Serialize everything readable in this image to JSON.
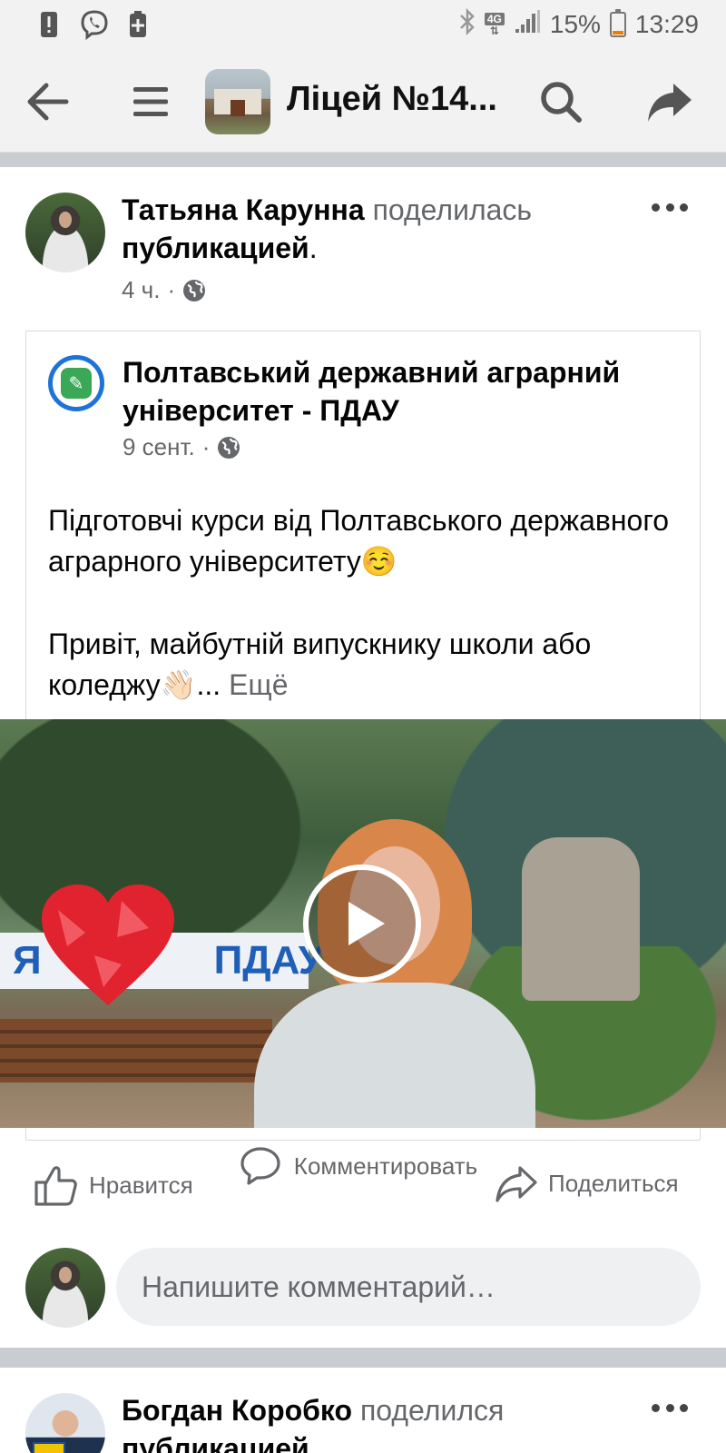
{
  "status_bar": {
    "battery_pct": "15%",
    "time": "13:29",
    "network": "4G",
    "battery_level": 0.15,
    "icons": [
      "alert-icon",
      "viber-icon",
      "battery-saver-icon",
      "bluetooth-icon",
      "network-4g-icon",
      "signal-icon",
      "battery-icon"
    ]
  },
  "app_bar": {
    "title": "Ліцей №14...",
    "icons": [
      "back-arrow-icon",
      "menu-icon",
      "search-icon",
      "share-icon"
    ]
  },
  "post1": {
    "author": "Татьяна Карунна",
    "action_text": "поделилась",
    "object_text": "публикацией",
    "period": ".",
    "time": "4 ч.",
    "dot": "·",
    "shared": {
      "page_name": "Полтавський державний аграрний університет - ПДАУ",
      "date": "9 сент.",
      "dot": "·",
      "text_line1": "Підготовчі курси від Полтавського державного аграрного університету☺️",
      "text_line2": "Привіт, майбутній випускнику школи або коледжу👋🏻...",
      "see_more": "Ещё",
      "video_sign_left": "Я",
      "video_sign_right": "ПДАУ"
    },
    "actions": {
      "like": "Нравится",
      "comment": "Комментировать",
      "share": "Поделиться"
    },
    "composer_placeholder": "Напишите комментарий…"
  },
  "post2": {
    "author": "Богдан Коробко",
    "action_text": "поделился",
    "object_text": "публикацией"
  },
  "colors": {
    "accent": "#1e73d8",
    "muted_text": "#65676b",
    "divider": "#c9ccd1",
    "app_bar_bg": "#f2f2f2"
  }
}
